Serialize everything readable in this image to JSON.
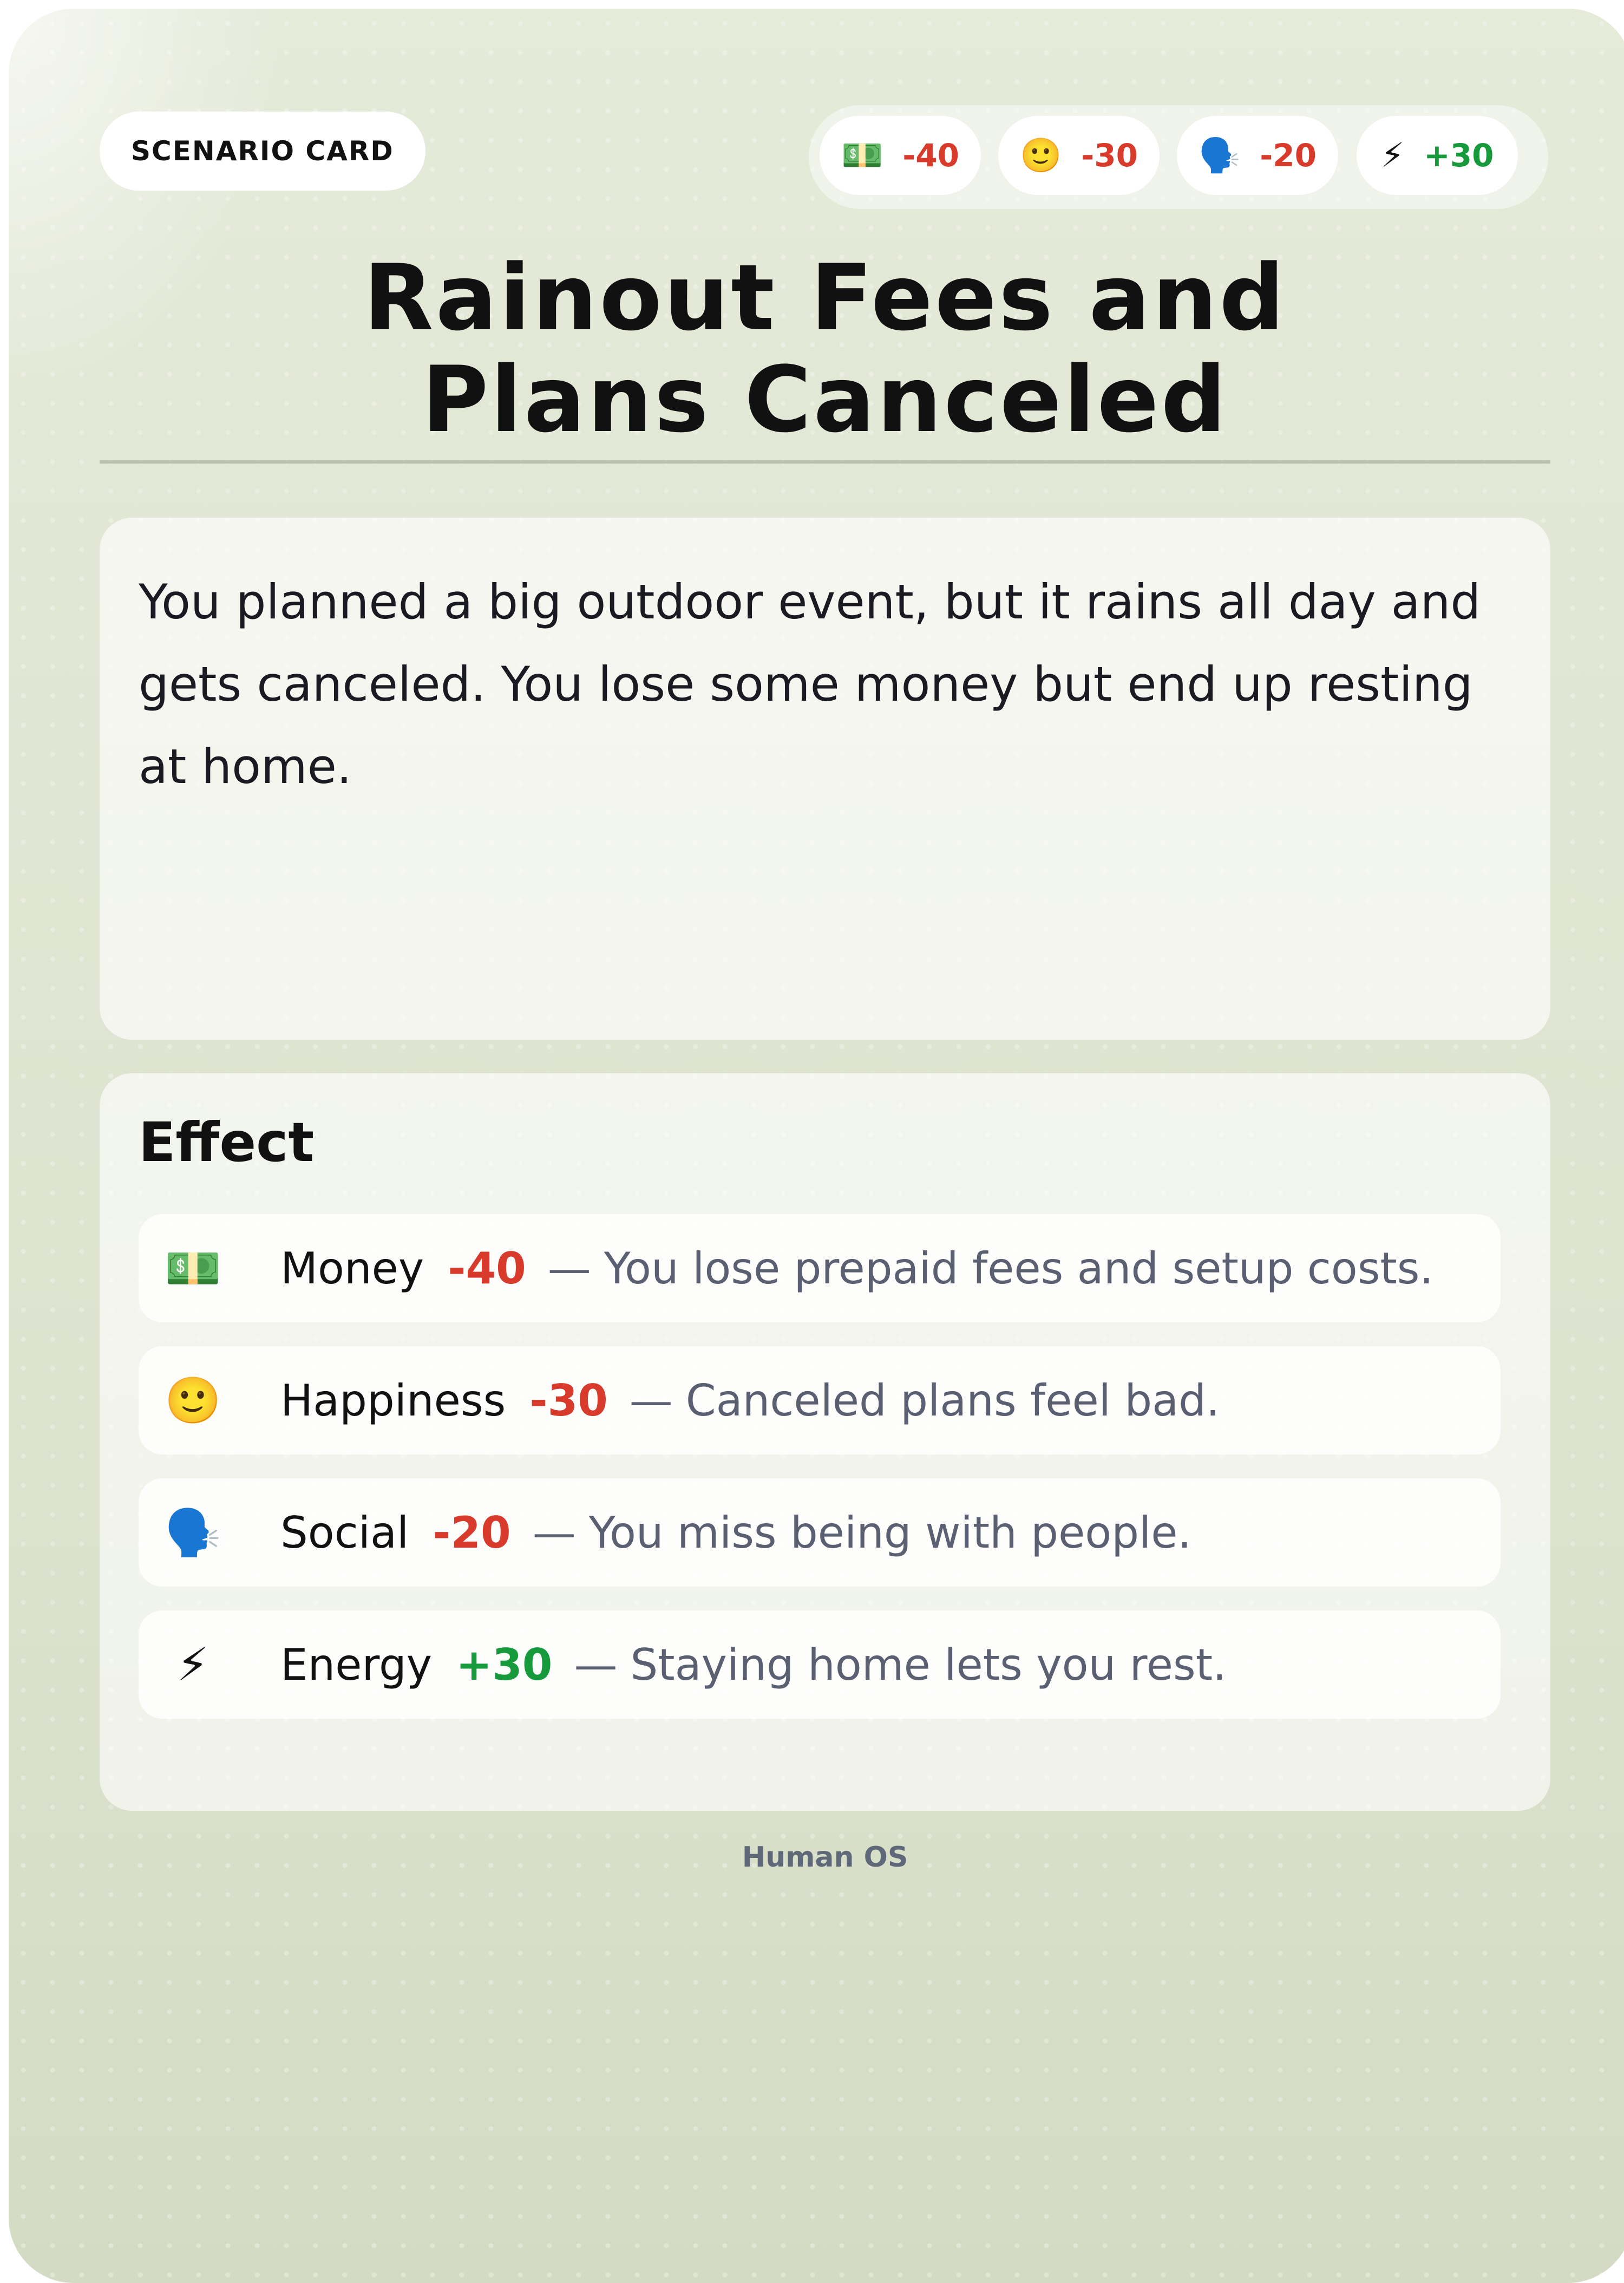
{
  "card": {
    "tag": "SCENARIO CARD",
    "title_line1": "Rainout Fees and",
    "title_line2": "Plans Canceled",
    "description": "You planned a big outdoor event, but it rains all day and gets canceled. You lose some money but end up resting at home.",
    "footer": "Human OS"
  },
  "stats": [
    {
      "icon": "money-icon",
      "glyph": "💵",
      "value": "-40"
    },
    {
      "icon": "smile-icon",
      "glyph": "🙂",
      "value": "-30"
    },
    {
      "icon": "speaking-head-icon",
      "glyph": "🗣️",
      "value": "-20"
    },
    {
      "icon": "lightning-icon",
      "glyph": "⚡",
      "value": "+30"
    }
  ],
  "effect": {
    "heading": "Effect",
    "rows": [
      {
        "icon": "money-icon",
        "glyph": "💵",
        "name": "Money",
        "value": "-40",
        "sep": "—",
        "note": "You lose prepaid fees and setup costs."
      },
      {
        "icon": "smile-icon",
        "glyph": "🙂",
        "name": "Happiness",
        "value": "-30",
        "sep": "—",
        "note": "Canceled plans feel bad."
      },
      {
        "icon": "speaking-head-icon",
        "glyph": "🗣️",
        "name": "Social",
        "value": "-20",
        "sep": "—",
        "note": "You miss being with people."
      },
      {
        "icon": "lightning-icon",
        "glyph": "⚡",
        "name": "Energy",
        "value": "+30",
        "sep": "—",
        "note": "Staying home lets you rest."
      }
    ]
  },
  "colors": {
    "negative": "#d83a2c",
    "positive": "#179a3c",
    "card_background": "#e3e8d6"
  }
}
